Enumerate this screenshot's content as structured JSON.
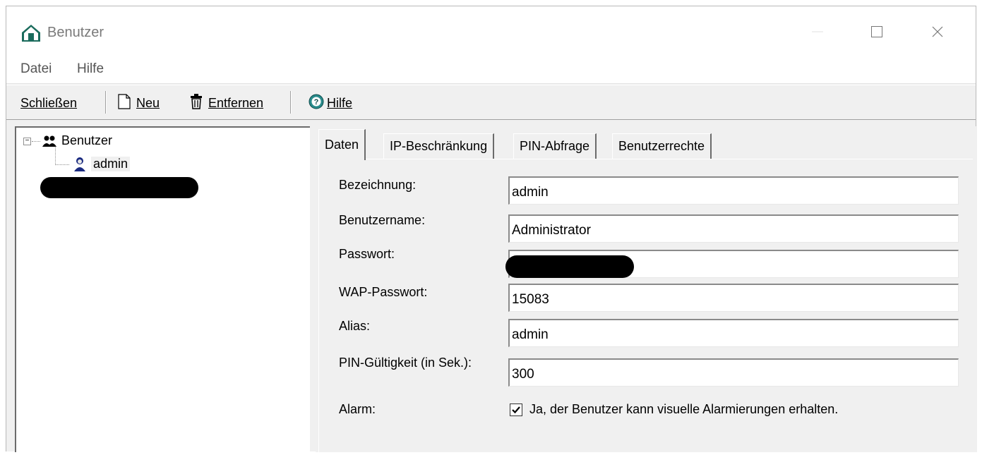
{
  "window": {
    "title": "Benutzer",
    "icon": "house-icon"
  },
  "menu": {
    "items": [
      {
        "label": "Datei"
      },
      {
        "label": "Hilfe"
      }
    ]
  },
  "toolbar": {
    "close_label": "Schließen",
    "new_label": "Neu",
    "remove_label": "Entfernen",
    "help_label": "Hilfe"
  },
  "tree": {
    "root_label": "Benutzer",
    "expander": "−",
    "child_label": "admin"
  },
  "tabs": [
    {
      "label": "Daten",
      "active": true
    },
    {
      "label": "IP-Beschränkung",
      "active": false
    },
    {
      "label": "PIN-Abfrage",
      "active": false
    },
    {
      "label": "Benutzerrechte",
      "active": false
    }
  ],
  "form": {
    "bezeichnung": {
      "label": "Bezeichnung:",
      "value": "admin"
    },
    "benutzername": {
      "label": "Benutzername:",
      "value": "Administrator"
    },
    "passwort": {
      "label": "Passwort:",
      "value": ""
    },
    "wap_passwort": {
      "label": "WAP-Passwort:",
      "value": "15083"
    },
    "alias": {
      "label": "Alias:",
      "value": "admin"
    },
    "pin_gueltigkeit": {
      "label": "PIN-Gültigkeit (in Sek.):",
      "value": "300"
    },
    "alarm": {
      "label": "Alarm:",
      "checkbox_label": "Ja, der Benutzer kann visuelle Alarmierungen erhalten.",
      "checked": true
    }
  },
  "colors": {
    "icon_teal": "#1a6b5c",
    "help_icon": "#2a8c8c"
  }
}
